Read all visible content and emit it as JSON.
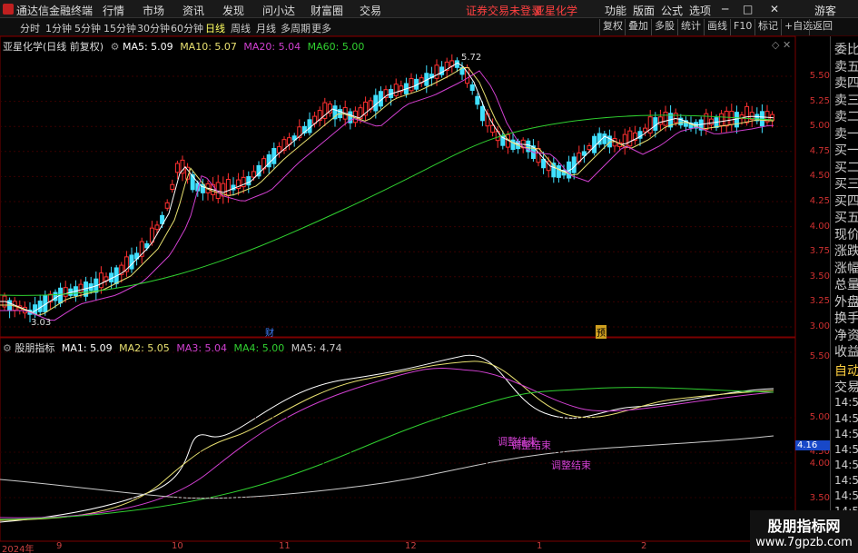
{
  "app": {
    "title": "通达信金融终端",
    "status": "证券交易未登录",
    "stock": "亚星化学",
    "user": "游客"
  },
  "menu": [
    "行情",
    "市场",
    "资讯",
    "发现",
    "问小达",
    "财富圈",
    "交易"
  ],
  "menu_right": [
    "功能",
    "版面",
    "公式",
    "选项"
  ],
  "periods": [
    "分时",
    "1分钟",
    "5分钟",
    "15分钟",
    "30分钟",
    "60分钟",
    "日线",
    "周线",
    "月线",
    "多周期",
    "更多"
  ],
  "tools": [
    "复权",
    "叠加",
    "多股",
    "统计",
    "画线",
    "F10",
    "标记",
    "+自选",
    "返回"
  ],
  "main": {
    "title": "亚星化学(日线 前复权)",
    "ma": [
      {
        "label": "MA5: 5.09",
        "color": "#ffffff"
      },
      {
        "label": "MA10: 5.07",
        "color": "#e8e070"
      },
      {
        "label": "MA20: 5.04",
        "color": "#d040d0"
      },
      {
        "label": "MA60: 5.00",
        "color": "#30d030"
      }
    ],
    "high_label": "5.72",
    "low_label": "3.03",
    "markers": [
      "财",
      "预"
    ],
    "ticks": [
      "5.50",
      "5.25",
      "5.00",
      "4.75",
      "4.50",
      "4.25",
      "4.00",
      "3.75",
      "3.50",
      "3.25",
      "3.00"
    ]
  },
  "indicator": {
    "title": "股朋指标",
    "lines": [
      {
        "label": "MA1: 5.09",
        "color": "#ffffff"
      },
      {
        "label": "MA2: 5.05",
        "color": "#e8e070"
      },
      {
        "label": "MA3: 5.04",
        "color": "#d040d0"
      },
      {
        "label": "MA4: 5.00",
        "color": "#30d030"
      },
      {
        "label": "MA5: 4.74",
        "color": "#cccccc"
      }
    ],
    "annotations": [
      "调整结束",
      "调整结束",
      "调整结束"
    ],
    "ticks": [
      "5.50",
      "5.00",
      "4.50",
      "4.00",
      "3.50"
    ],
    "current": "4.16"
  },
  "side": [
    "委比",
    "卖五",
    "卖四",
    "卖三",
    "卖二",
    "卖一",
    "买一",
    "买二",
    "买三",
    "买四",
    "买五",
    "现价",
    "涨跌",
    "涨幅",
    "总量",
    "外盘",
    "换手",
    "净资",
    "收益",
    "自动",
    "交易",
    "14:55",
    "14:56",
    "14:56",
    "14:56",
    "14:56",
    "14:56",
    "14:56",
    "14:56"
  ],
  "dates": [
    "2024年",
    "9",
    "10",
    "11",
    "12",
    "1",
    "2"
  ],
  "watermark": {
    "title": "股朋指标网",
    "url": "www.7gpzb.com"
  }
}
